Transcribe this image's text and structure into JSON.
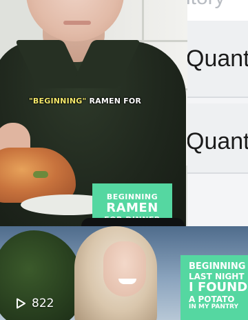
{
  "tiles": {
    "top": {
      "caption_highlight": "\"BEGINNING\"",
      "caption_rest": "RAMEN FOR",
      "card_line1": "BEGINNING",
      "card_line2": "RAMEN",
      "card_line3": "FOR DINNER"
    },
    "right": {
      "fragment_top": "itory",
      "label_1": "Quant",
      "label_2": "Quant"
    },
    "bottom": {
      "card_line1": "BEGINNING",
      "card_line2": "LAST NIGHT",
      "card_line3": "I FOUND",
      "card_line4": "A POTATO",
      "card_line5": "IN MY PANTRY"
    }
  },
  "overlay": {
    "view_count": "822",
    "icon": "play-icon"
  },
  "colors": {
    "accent_green": "#55d7a1",
    "caption_highlight": "#f4e86a"
  }
}
